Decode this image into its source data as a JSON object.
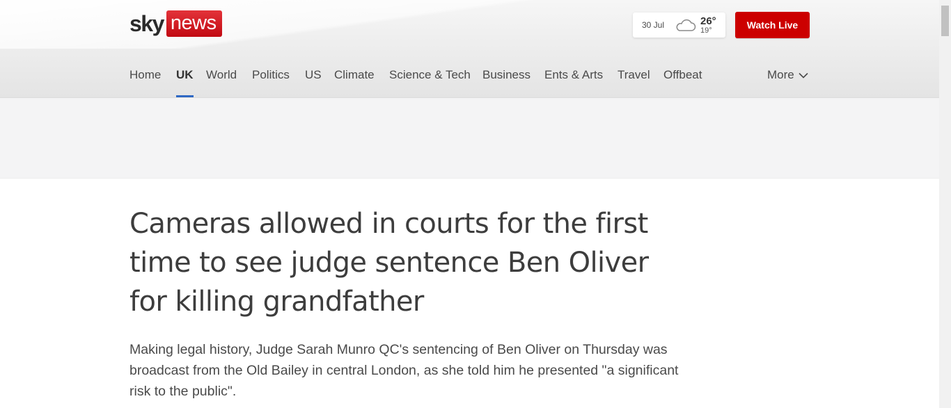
{
  "logo": {
    "sky": "sky",
    "news": "news"
  },
  "weather": {
    "date": "30 Jul",
    "high": "26°",
    "low": "19°",
    "icon": "cloud-icon"
  },
  "watch_live": "Watch Live",
  "nav": {
    "items": [
      {
        "label": "Home",
        "active": false
      },
      {
        "label": "UK",
        "active": true
      },
      {
        "label": "World",
        "active": false
      },
      {
        "label": "Politics",
        "active": false
      },
      {
        "label": "US",
        "active": false
      },
      {
        "label": "Climate",
        "active": false
      },
      {
        "label": "Science & Tech",
        "active": false
      },
      {
        "label": "Business",
        "active": false
      },
      {
        "label": "Ents & Arts",
        "active": false
      },
      {
        "label": "Travel",
        "active": false
      },
      {
        "label": "Offbeat",
        "active": false
      }
    ],
    "more": "More"
  },
  "article": {
    "headline": "Cameras allowed in courts for the first time to see judge sentence Ben Oliver for killing grandfather",
    "standfirst": "Making legal history, Judge Sarah Munro QC's sentencing of Ben Oliver on Thursday was broadcast from the Old Bailey in central London, as she told him he presented \"a significant risk to the public\"."
  },
  "colors": {
    "brand_red": "#cc0000",
    "active_underline": "#2f68c4"
  }
}
